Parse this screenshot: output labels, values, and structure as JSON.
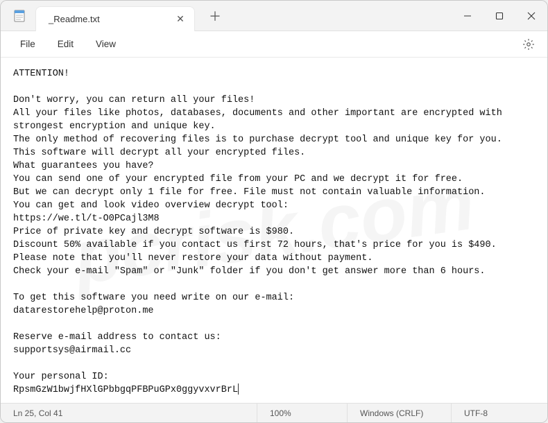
{
  "titlebar": {
    "tab_title": "_Readme.txt",
    "close_glyph": "✕",
    "newtab_glyph": "＋"
  },
  "menubar": {
    "file": "File",
    "edit": "Edit",
    "view": "View"
  },
  "document": {
    "text": "ATTENTION!\n\nDon't worry, you can return all your files!\nAll your files like photos, databases, documents and other important are encrypted with strongest encryption and unique key.\nThe only method of recovering files is to purchase decrypt tool and unique key for you.\nThis software will decrypt all your encrypted files.\nWhat guarantees you have?\nYou can send one of your encrypted file from your PC and we decrypt it for free.\nBut we can decrypt only 1 file for free. File must not contain valuable information.\nYou can get and look video overview decrypt tool:\nhttps://we.tl/t-O0PCajl3M8\nPrice of private key and decrypt software is $980.\nDiscount 50% available if you contact us first 72 hours, that's price for you is $490.\nPlease note that you'll never restore your data without payment.\nCheck your e-mail \"Spam\" or \"Junk\" folder if you don't get answer more than 6 hours.\n\nTo get this software you need write on our e-mail:\ndatarestorehelp@proton.me\n\nReserve e-mail address to contact us:\nsupportsys@airmail.cc\n\nYour personal ID:\nRpsmGzW1bwjfHXlGPbbgqPFBPuGPx0ggyvxvrBrL"
  },
  "statusbar": {
    "position": "Ln 25, Col 41",
    "zoom": "100%",
    "eol": "Windows (CRLF)",
    "encoding": "UTF-8"
  },
  "watermark": "pcrisk.com"
}
